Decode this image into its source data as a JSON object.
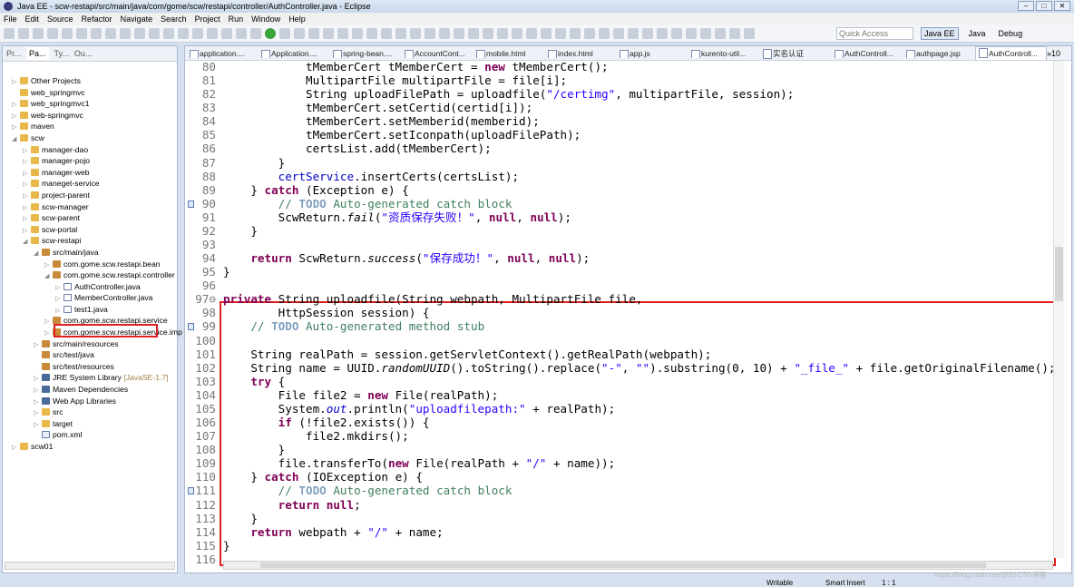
{
  "window": {
    "title": "Java EE - scw-restapi/src/main/java/com/gome/scw/restapi/controller/AuthController.java - Eclipse"
  },
  "menu": [
    "File",
    "Edit",
    "Source",
    "Refactor",
    "Navigate",
    "Search",
    "Project",
    "Run",
    "Window",
    "Help"
  ],
  "toolbar": {
    "quick_access_placeholder": "Quick Access",
    "perspectives": [
      "Java EE",
      "Java",
      "Debug"
    ],
    "active_perspective": "Java EE"
  },
  "left_panel": {
    "tabs": [
      "Pr...",
      "Pa...",
      "Ty...",
      "Ou..."
    ],
    "active_tab": "Pa...",
    "tree": [
      {
        "d": 0,
        "tw": "▷",
        "ic": "proj",
        "label": "Other Projects"
      },
      {
        "d": 0,
        "tw": "",
        "ic": "proj",
        "label": "web_springmvc"
      },
      {
        "d": 0,
        "tw": "▷",
        "ic": "proj",
        "label": "web_springmvc1"
      },
      {
        "d": 0,
        "tw": "▷",
        "ic": "proj",
        "label": "web-springmvc"
      },
      {
        "d": 0,
        "tw": "▷",
        "ic": "proj",
        "label": "maven"
      },
      {
        "d": 0,
        "tw": "◢",
        "ic": "proj",
        "label": "scw"
      },
      {
        "d": 1,
        "tw": "▷",
        "ic": "proj",
        "label": "manager-dao"
      },
      {
        "d": 1,
        "tw": "▷",
        "ic": "proj",
        "label": "manager-pojo"
      },
      {
        "d": 1,
        "tw": "▷",
        "ic": "proj",
        "label": "manager-web"
      },
      {
        "d": 1,
        "tw": "▷",
        "ic": "proj",
        "label": "maneget-service"
      },
      {
        "d": 1,
        "tw": "▷",
        "ic": "proj",
        "label": "project-parent"
      },
      {
        "d": 1,
        "tw": "▷",
        "ic": "proj",
        "label": "scw-manager"
      },
      {
        "d": 1,
        "tw": "▷",
        "ic": "proj",
        "label": "scw-parent"
      },
      {
        "d": 1,
        "tw": "▷",
        "ic": "proj",
        "label": "scw-portal"
      },
      {
        "d": 1,
        "tw": "◢",
        "ic": "proj",
        "label": "scw-restapi"
      },
      {
        "d": 2,
        "tw": "◢",
        "ic": "pkg",
        "label": "src/main/java"
      },
      {
        "d": 3,
        "tw": "▷",
        "ic": "pkg",
        "label": "com.gome.scw.restapi.bean"
      },
      {
        "d": 3,
        "tw": "◢",
        "ic": "pkg",
        "label": "com.gome.scw.restapi.controller"
      },
      {
        "d": 4,
        "tw": "▷",
        "ic": "java",
        "label": "AuthController.java"
      },
      {
        "d": 4,
        "tw": "▷",
        "ic": "java",
        "label": "MemberController.java"
      },
      {
        "d": 4,
        "tw": "▷",
        "ic": "java",
        "label": "test1.java"
      },
      {
        "d": 3,
        "tw": "▷",
        "ic": "pkg",
        "label": "com.gome.scw.restapi.service"
      },
      {
        "d": 3,
        "tw": "▷",
        "ic": "pkg",
        "label": "com.gome.scw.restapi.service.imp"
      },
      {
        "d": 2,
        "tw": "▷",
        "ic": "pkg",
        "label": "src/main/resources"
      },
      {
        "d": 2,
        "tw": "",
        "ic": "pkg",
        "label": "src/test/java"
      },
      {
        "d": 2,
        "tw": "",
        "ic": "pkg",
        "label": "src/test/resources"
      },
      {
        "d": 2,
        "tw": "▷",
        "ic": "lib",
        "label": "JRE System Library",
        "deco": "[JavaSE-1.7]"
      },
      {
        "d": 2,
        "tw": "▷",
        "ic": "lib",
        "label": "Maven Dependencies"
      },
      {
        "d": 2,
        "tw": "▷",
        "ic": "lib",
        "label": "Web App Libraries"
      },
      {
        "d": 2,
        "tw": "▷",
        "ic": "proj",
        "label": "src"
      },
      {
        "d": 2,
        "tw": "▷",
        "ic": "proj",
        "label": "target"
      },
      {
        "d": 2,
        "tw": "",
        "ic": "xml",
        "label": "pom.xml"
      },
      {
        "d": 0,
        "tw": "▷",
        "ic": "proj",
        "label": "scw01"
      }
    ]
  },
  "editor": {
    "tabs": [
      "application....",
      "Application....",
      "spring-bean....",
      "AccountCont...",
      "mobile.html",
      "index.html",
      "app.js",
      "kurento-util...",
      "实名认证",
      "AuthControll...",
      "authpage.jsp",
      "AuthControll..."
    ],
    "active_tab_index": 11,
    "overflow": "»10",
    "lines": [
      {
        "n": 80,
        "seg": [
          [
            "",
            "            tMemberCert tMemberCert = "
          ],
          [
            "k",
            "new"
          ],
          [
            "",
            " tMemberCert();"
          ]
        ]
      },
      {
        "n": 81,
        "seg": [
          [
            "",
            "            MultipartFile multipartFile = file[i];"
          ]
        ]
      },
      {
        "n": 82,
        "seg": [
          [
            "",
            "            String uploadFilePath = uploadfile("
          ],
          [
            "s",
            "\"/certimg\""
          ],
          [
            "",
            ", multipartFile, session);"
          ]
        ]
      },
      {
        "n": 83,
        "seg": [
          [
            "",
            "            tMemberCert.setCertid(certid[i]);"
          ]
        ]
      },
      {
        "n": 84,
        "seg": [
          [
            "",
            "            tMemberCert.setMemberid(memberid);"
          ]
        ]
      },
      {
        "n": 85,
        "seg": [
          [
            "",
            "            tMemberCert.setIconpath(uploadFilePath);"
          ]
        ]
      },
      {
        "n": 86,
        "seg": [
          [
            "",
            "            certsList.add(tMemberCert);"
          ]
        ]
      },
      {
        "n": 87,
        "seg": [
          [
            "",
            "        }"
          ]
        ]
      },
      {
        "n": 88,
        "seg": [
          [
            "",
            "        "
          ],
          [
            "b",
            "certService"
          ],
          [
            "",
            ".insertCerts(certsList);"
          ]
        ]
      },
      {
        "n": 89,
        "seg": [
          [
            "",
            "    } "
          ],
          [
            "k",
            "catch"
          ],
          [
            "",
            " (Exception e) {"
          ]
        ]
      },
      {
        "n": 90,
        "mark": true,
        "seg": [
          [
            "",
            "        "
          ],
          [
            "c",
            "// "
          ],
          [
            "t",
            "TODO"
          ],
          [
            "c",
            " Auto-generated catch block"
          ]
        ]
      },
      {
        "n": 91,
        "seg": [
          [
            "",
            "        ScwReturn."
          ],
          [
            "i",
            "fail"
          ],
          [
            "",
            "("
          ],
          [
            "s",
            "\"资质保存失败！\""
          ],
          [
            "",
            ", "
          ],
          [
            "k",
            "null"
          ],
          [
            "",
            ", "
          ],
          [
            "k",
            "null"
          ],
          [
            "",
            ");"
          ]
        ]
      },
      {
        "n": 92,
        "seg": [
          [
            "",
            "    }"
          ]
        ]
      },
      {
        "n": 93,
        "seg": []
      },
      {
        "n": 94,
        "seg": [
          [
            "",
            "    "
          ],
          [
            "k",
            "return"
          ],
          [
            "",
            " ScwReturn."
          ],
          [
            "i",
            "success"
          ],
          [
            "",
            "("
          ],
          [
            "s",
            "\"保存成功！\""
          ],
          [
            "",
            ", "
          ],
          [
            "k",
            "null"
          ],
          [
            "",
            ", "
          ],
          [
            "k",
            "null"
          ],
          [
            "",
            ");"
          ]
        ]
      },
      {
        "n": 95,
        "seg": [
          [
            "",
            "}"
          ]
        ]
      },
      {
        "n": 96,
        "seg": []
      },
      {
        "n": "97⊖",
        "seg": [
          [
            "k",
            "private"
          ],
          [
            "",
            " String uploadfile(String webpath, MultipartFile file,"
          ]
        ]
      },
      {
        "n": 98,
        "seg": [
          [
            "",
            "        HttpSession session) {"
          ]
        ]
      },
      {
        "n": 99,
        "mark": true,
        "seg": [
          [
            "",
            "    "
          ],
          [
            "c",
            "// "
          ],
          [
            "t",
            "TODO"
          ],
          [
            "c",
            " Auto-generated method stub"
          ]
        ]
      },
      {
        "n": 100,
        "seg": []
      },
      {
        "n": 101,
        "seg": [
          [
            "",
            "    String realPath = session.getServletContext().getRealPath(webpath);"
          ]
        ]
      },
      {
        "n": 102,
        "seg": [
          [
            "",
            "    String name = UUID."
          ],
          [
            "i",
            "randomUUID"
          ],
          [
            "",
            "().toString().replace("
          ],
          [
            "s",
            "\"-\""
          ],
          [
            "",
            ", "
          ],
          [
            "s",
            "\"\""
          ],
          [
            "",
            ").substring(0, 10) + "
          ],
          [
            "s",
            "\"_file_\""
          ],
          [
            "",
            " + file.getOriginalFilename();"
          ]
        ]
      },
      {
        "n": 103,
        "seg": [
          [
            "",
            "    "
          ],
          [
            "k",
            "try"
          ],
          [
            "",
            " {"
          ]
        ]
      },
      {
        "n": 104,
        "seg": [
          [
            "",
            "        File file2 = "
          ],
          [
            "k",
            "new"
          ],
          [
            "",
            " File(realPath);"
          ]
        ]
      },
      {
        "n": 105,
        "seg": [
          [
            "",
            "        System."
          ],
          [
            "f",
            "out"
          ],
          [
            "",
            ".println("
          ],
          [
            "s",
            "\"uploadfilepath:\""
          ],
          [
            "",
            " + realPath);"
          ]
        ]
      },
      {
        "n": 106,
        "seg": [
          [
            "",
            "        "
          ],
          [
            "k",
            "if"
          ],
          [
            "",
            " (!file2.exists()) {"
          ]
        ]
      },
      {
        "n": 107,
        "seg": [
          [
            "",
            "            file2.mkdirs();"
          ]
        ]
      },
      {
        "n": 108,
        "seg": [
          [
            "",
            "        }"
          ]
        ]
      },
      {
        "n": 109,
        "seg": [
          [
            "",
            "        file.transferTo("
          ],
          [
            "k",
            "new"
          ],
          [
            "",
            " File(realPath + "
          ],
          [
            "s",
            "\"/\""
          ],
          [
            "",
            " + name));"
          ]
        ]
      },
      {
        "n": 110,
        "seg": [
          [
            "",
            "    } "
          ],
          [
            "k",
            "catch"
          ],
          [
            "",
            " (IOException e) {"
          ]
        ]
      },
      {
        "n": 111,
        "mark": true,
        "seg": [
          [
            "",
            "        "
          ],
          [
            "c",
            "// "
          ],
          [
            "t",
            "TODO"
          ],
          [
            "c",
            " Auto-generated catch block"
          ]
        ]
      },
      {
        "n": 112,
        "seg": [
          [
            "",
            "        "
          ],
          [
            "k",
            "return"
          ],
          [
            "",
            ""
          ],
          [
            "k",
            " null"
          ],
          [
            "",
            ";"
          ]
        ]
      },
      {
        "n": 113,
        "seg": [
          [
            "",
            "    }"
          ]
        ]
      },
      {
        "n": 114,
        "seg": [
          [
            "",
            "    "
          ],
          [
            "k",
            "return"
          ],
          [
            "",
            " webpath + "
          ],
          [
            "s",
            "\"/\""
          ],
          [
            "",
            " + name;"
          ]
        ]
      },
      {
        "n": 115,
        "seg": [
          [
            "",
            "}"
          ]
        ]
      },
      {
        "n": 116,
        "seg": []
      }
    ]
  },
  "status": {
    "writable": "Writable",
    "insert_mode": "Smart Insert",
    "position": "1 : 1"
  },
  "watermark": "https://blog.csdn.net/@51CTO博客",
  "colors": {
    "highlight_box": "#e02020",
    "keyword": "#7f0055",
    "string": "#2a00ff",
    "comment": "#3f7f5f"
  }
}
